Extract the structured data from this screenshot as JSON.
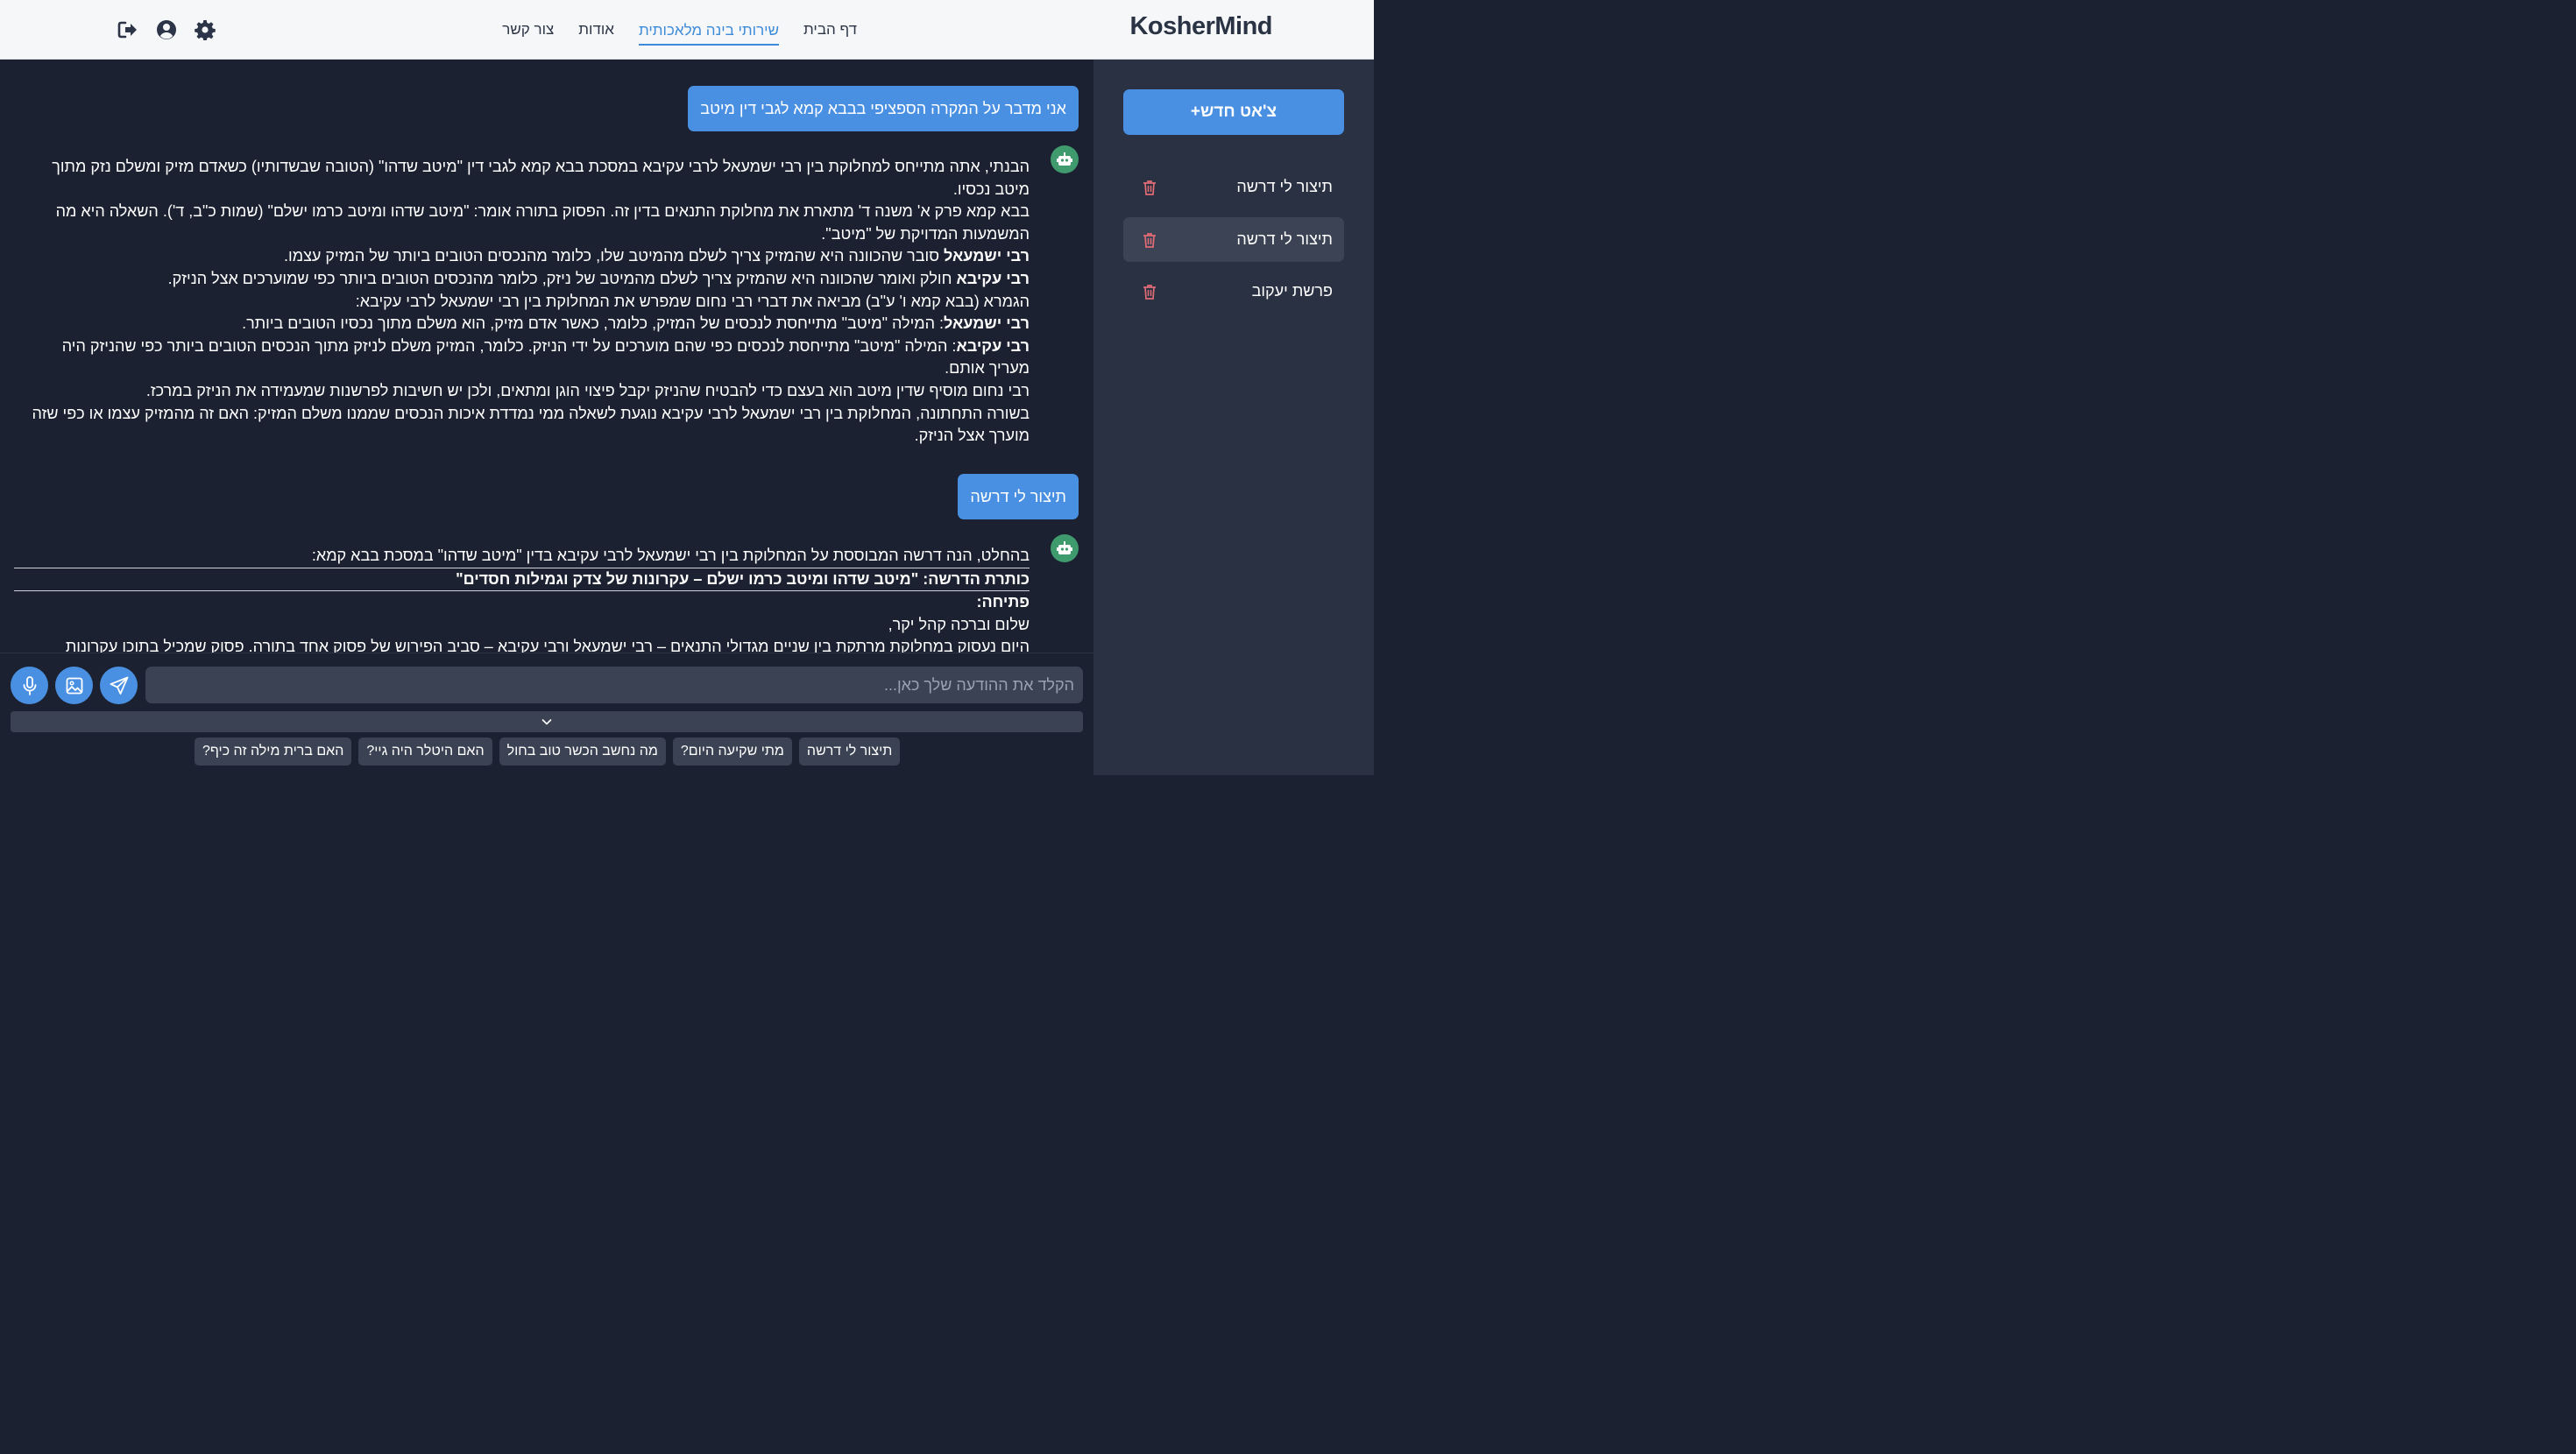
{
  "header": {
    "logo": "KosherMind",
    "nav": [
      {
        "label": "דף הבית",
        "active": false
      },
      {
        "label": "שירותי בינה מלאכותית",
        "active": true
      },
      {
        "label": "אודות",
        "active": false
      },
      {
        "label": "צור קשר",
        "active": false
      }
    ],
    "icons": [
      "settings-icon",
      "user-circle-icon",
      "logout-icon"
    ]
  },
  "sidebar": {
    "new_chat_label": "צ'אט חדש+",
    "chats": [
      {
        "title": "תיצור לי דרשה",
        "active": false
      },
      {
        "title": "תיצור לי דרשה",
        "active": true
      },
      {
        "title": "פרשת יעקוב",
        "active": false
      }
    ]
  },
  "messages": {
    "user1": "אני מדבר על המקרה הספציפי בבבא קמא לגבי דין מיטב",
    "bot1": {
      "lines": [
        "הבנתי, אתה מתייחס למחלוקת בין רבי ישמעאל לרבי עקיבא במסכת בבא קמא לגבי דין \"מיטב שדהו\" (הטובה שבשדותיו) כשאדם מזיק ומשלם נזק מתוך מיטב נכסיו.",
        "בבא קמא פרק א' משנה ד' מתארת את מחלוקת התנאים בדין זה. הפסוק בתורה אומר: \"מיטב שדהו ומיטב כרמו ישלם\" (שמות כ\"ב, ד'). השאלה היא מה המשמעות המדויקת של \"מיטב\"."
      ],
      "r1_name": "רבי ישמעאל",
      "r1_text": " סובר שהכוונה היא שהמזיק צריך לשלם מהמיטב שלו, כלומר מהנכסים הטובים ביותר של המזיק עצמו.",
      "r2_name": "רבי עקיבא",
      "r2_text": " חולק ואומר שהכוונה היא שהמזיק צריך לשלם מהמיטב של ניזק, כלומר מהנכסים הטובים ביותר כפי שמוערכים אצל הניזק.",
      "gemara": "הגמרא (בבא קמא ו' ע\"ב) מביאה את דברי רבי נחום שמפרש את המחלוקת בין רבי ישמעאל לרבי עקיבא:",
      "r3_name": "רבי ישמעאל",
      "r3_text": ": המילה \"מיטב\" מתייחסת לנכסים של המזיק, כלומר, כאשר אדם מזיק, הוא משלם מתוך נכסיו הטובים ביותר.",
      "r4_name": "רבי עקיבא",
      "r4_text": ": המילה \"מיטב\" מתייחסת לנכסים כפי שהם מוערכים על ידי הניזק. כלומר, המזיק משלם לניזק מתוך הנכסים הטובים ביותר כפי שהניזק היה מעריך אותם.",
      "nachum": "רבי נחום מוסיף שדין מיטב הוא בעצם כדי להבטיח שהניזק יקבל פיצוי הוגן ומתאים, ולכן יש חשיבות לפרשנות שמעמידה את הניזק במרכז.",
      "summary": "בשורה התחתונה, המחלוקת בין רבי ישמעאל לרבי עקיבא נוגעת לשאלה ממי נמדדת איכות הנכסים שממנו משלם המזיק: האם זה מהמזיק עצמו או כפי שזה מוערך אצל הניזק."
    },
    "user2": "תיצור לי דרשה",
    "bot2": {
      "intro": "בהחלט, הנה דרשה המבוססת על המחלוקת בין רבי ישמעאל לרבי עקיבא בדין \"מיטב שדהו\" במסכת בבא קמא:",
      "title": "כותרת הדרשה: \"מיטב שדהו ומיטב כרמו ישלם – עקרונות של צדק וגמילות חסדים\"",
      "opening": "פתיחה:",
      "greeting": "שלום וברכה קהל יקר,",
      "cut_line": "היום נעסוק במחלוקת מרתקת בין שניים מגדולי התנאים – רבי ישמעאל ורבי עקיבא – סביב הפירוש של פסוק אחד בתורה. פסוק שמכיל בתוכו עקרונות"
    }
  },
  "composer": {
    "placeholder": "הקלד את ההודעה שלך כאן...",
    "suggestions": [
      "תיצור לי דרשה",
      "מתי שקיעה היום?",
      "מה נחשב הכשר טוב בחול",
      "האם היטלר היה גיי?",
      "האם ברית מילה זה כיף?"
    ]
  },
  "colors": {
    "accent": "#4a90e2",
    "bot_avatar": "#3f9a6e",
    "trash": "#e06c75"
  }
}
